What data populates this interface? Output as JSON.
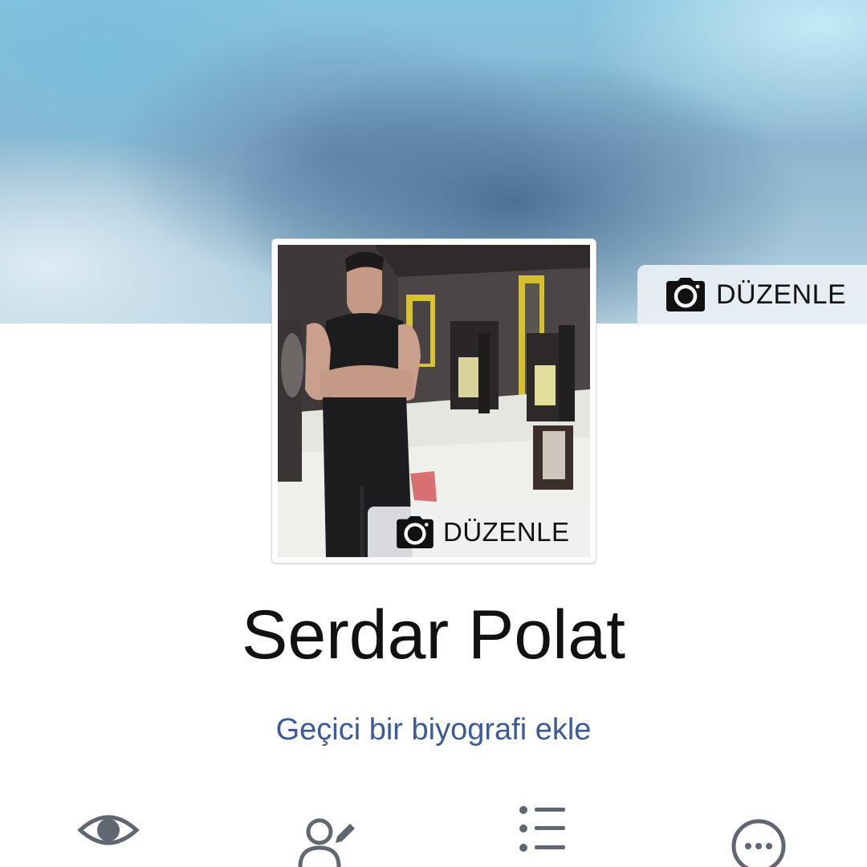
{
  "cover": {
    "edit_label": "DÜZENLE",
    "edit_icon": "camera-icon"
  },
  "profile_picture": {
    "edit_label": "DÜZENLE",
    "edit_icon": "camera-icon"
  },
  "profile": {
    "name": "Serdar Polat",
    "bio_link": "Geçici bir biyografi ekle"
  },
  "actions": [
    {
      "icon": "eye-icon"
    },
    {
      "icon": "edit-profile-icon"
    },
    {
      "icon": "activity-log-icon"
    },
    {
      "icon": "more-icon"
    }
  ],
  "colors": {
    "link": "#3b5a98",
    "icon": "#606770"
  }
}
